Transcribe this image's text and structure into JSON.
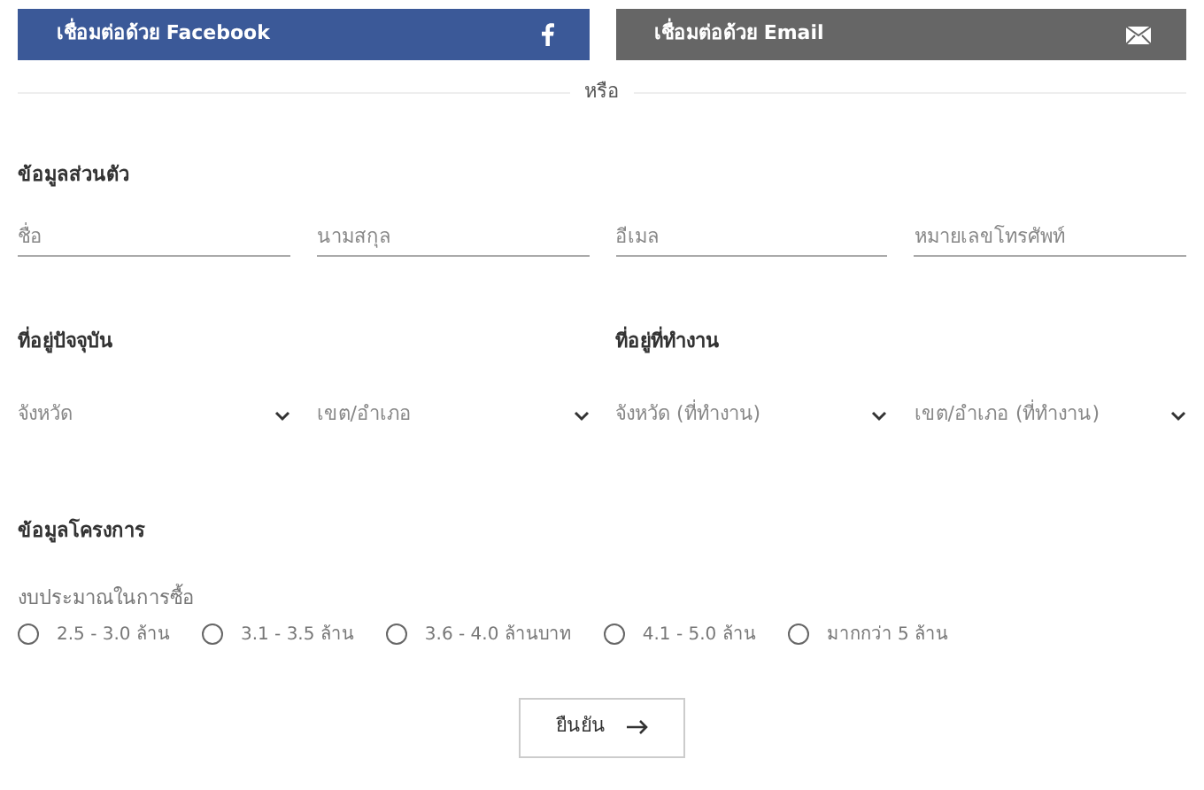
{
  "social_buttons": [
    {
      "kind": "facebook",
      "label": "เชื่อมต่อด้วย Facebook"
    },
    {
      "kind": "email",
      "label": "เชื่อมต่อด้วย Email"
    }
  ],
  "divider": "หรือ",
  "personal": {
    "title": "ข้อมูลส่วนตัว",
    "fields": [
      {
        "placeholder": "ชื่อ"
      },
      {
        "placeholder": "นามสกุล"
      },
      {
        "placeholder": "อีเมล"
      },
      {
        "placeholder": "หมายเลขโทรศัพท์"
      }
    ]
  },
  "addresses": [
    {
      "title": "ที่อยู่ปัจจุบัน",
      "selects": [
        {
          "placeholder": "จังหวัด"
        },
        {
          "placeholder": "เขต/อำเภอ"
        }
      ]
    },
    {
      "title": "ที่อยู่ที่ทำงาน",
      "selects": [
        {
          "placeholder": "จังหวัด (ที่ทำงาน)"
        },
        {
          "placeholder": "เขต/อำเภอ (ที่ทำงาน)"
        }
      ]
    }
  ],
  "project": {
    "title": "ข้อมูลโครงการ",
    "budget_label": "งบประมาณในการซื้อ",
    "options": [
      {
        "label": "2.5 - 3.0 ล้าน",
        "selected": false
      },
      {
        "label": "3.1 - 3.5 ล้าน",
        "selected": false
      },
      {
        "label": "3.6 - 4.0 ล้านบาท",
        "selected": false
      },
      {
        "label": "4.1 - 5.0 ล้าน",
        "selected": false
      },
      {
        "label": "มากกว่า 5 ล้าน",
        "selected": false
      }
    ]
  },
  "submit": "ยืนยัน"
}
